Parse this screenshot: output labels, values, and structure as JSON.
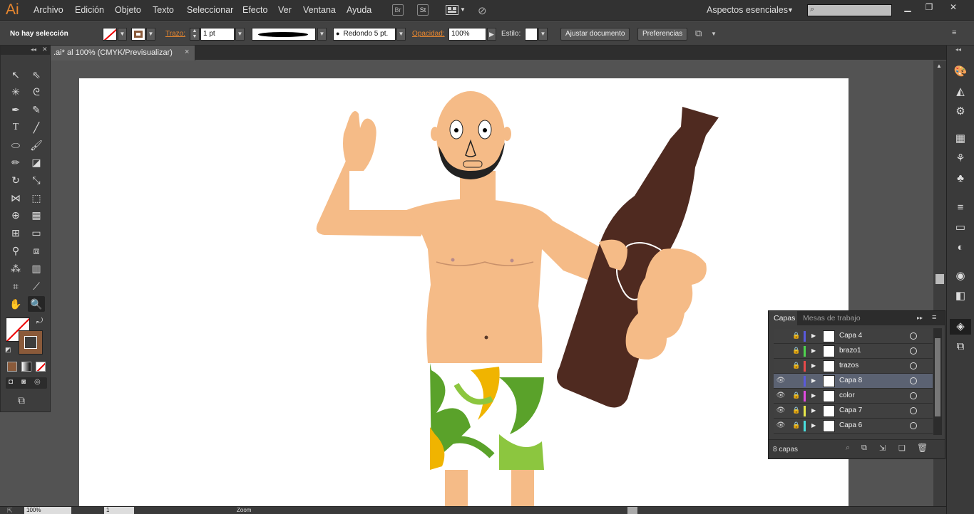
{
  "app": {
    "logo": "Ai",
    "menu": [
      "Archivo",
      "Edición",
      "Objeto",
      "Texto",
      "Seleccionar",
      "Efecto",
      "Ver",
      "Ventana",
      "Ayuda"
    ],
    "workspace": "Aspectos esenciales",
    "bridge_icon": "Br",
    "stock_icon": "St"
  },
  "control": {
    "selection": "No hay selección",
    "stroke_label": "Trazo:",
    "stroke_value": "1 pt",
    "cap_label": "Redondo 5 pt.",
    "opacity_label": "Opacidad:",
    "opacity_value": "100%",
    "style_label": "Estilo:",
    "fit_button": "Ajustar documento",
    "prefs_button": "Preferencias"
  },
  "document": {
    "tab_title": ".ai* al 100% (CMYK/Previsualizar)",
    "close": "×"
  },
  "status": {
    "zoom": "100%",
    "page": "1",
    "mode": "Zoom"
  },
  "layers_panel": {
    "tab_layers": "Capas",
    "tab_artboards": "Mesas de trabajo",
    "count": "8 capas",
    "rows": [
      {
        "name": "Capa 4",
        "visible": false,
        "color": "#5a5adc",
        "selected": false
      },
      {
        "name": "brazo1",
        "visible": false,
        "color": "#4fd34f",
        "selected": false
      },
      {
        "name": "trazos",
        "visible": false,
        "color": "#e84a4a",
        "selected": false
      },
      {
        "name": "Capa 8",
        "visible": true,
        "color": "#5a5adc",
        "selected": true
      },
      {
        "name": "color",
        "visible": true,
        "color": "#e04ae0",
        "selected": false
      },
      {
        "name": "Capa 7",
        "visible": true,
        "color": "#e8e84a",
        "selected": false
      },
      {
        "name": "Capa 6",
        "visible": true,
        "color": "#4ae0e0",
        "selected": false
      }
    ]
  },
  "colors": {
    "skin": "#f5bb87",
    "bottle": "#4f2a20",
    "shorts_green": "#5aa22a",
    "shorts_yellow": "#f0b400",
    "accent": "#e8872f"
  }
}
